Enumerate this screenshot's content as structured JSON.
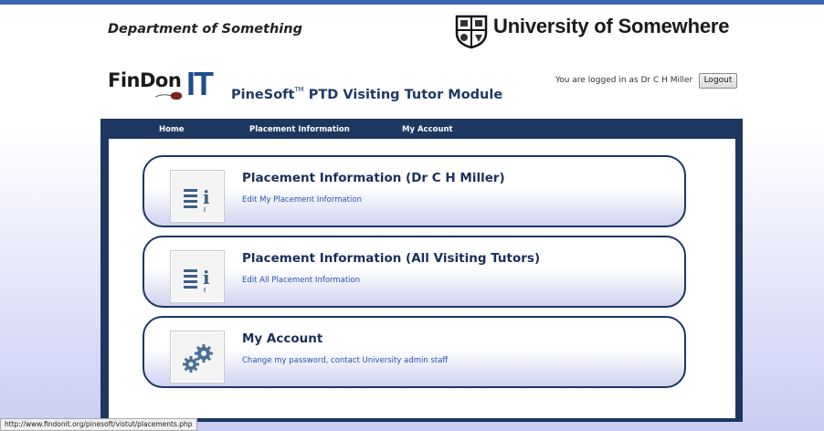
{
  "header": {
    "department": "Department of Something",
    "university": "University of Somewhere"
  },
  "logo": {
    "text_fin": "FinDon",
    "text_it": "IT",
    "icon": "computer-mouse-icon"
  },
  "module": {
    "name_prefix": "PineSoft",
    "trademark": "TM",
    "name_suffix": " PTD Visiting Tutor Module"
  },
  "session": {
    "logged_in_text": "You are logged in as Dr C H Miller",
    "logout_label": "Logout"
  },
  "nav": {
    "items": [
      {
        "label": "Home"
      },
      {
        "label": "Placement Information"
      },
      {
        "label": "My Account"
      }
    ]
  },
  "cards": [
    {
      "title": "Placement Information (Dr C H Miller)",
      "link": "Edit My Placement Information",
      "icon": "list-info-icon"
    },
    {
      "title": "Placement Information (All Visiting Tutors)",
      "link": "Edit All Placement Information",
      "icon": "list-info-icon"
    },
    {
      "title": "My Account",
      "link": "Change my password, contact University admin staff",
      "icon": "gears-icon"
    }
  ],
  "status_bar": {
    "url": "http://www.findonit.org/pinesoft/vistut/placements.php"
  },
  "colors": {
    "nav_background": "#1d3760",
    "link": "#2553b0",
    "card_border": "#1d3760",
    "title": "#1a2f5c"
  }
}
